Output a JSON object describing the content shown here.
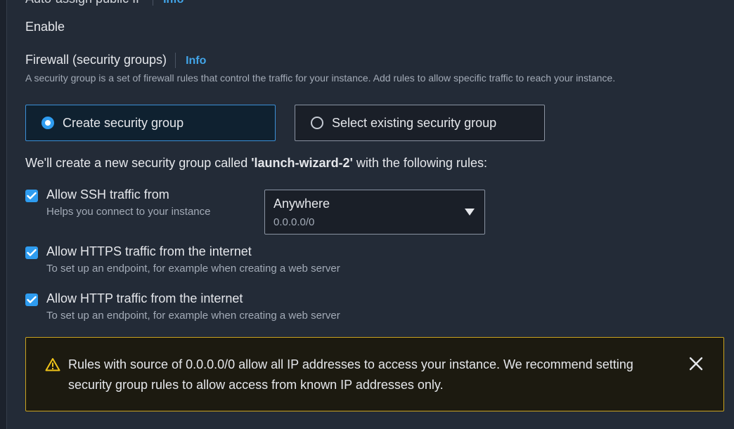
{
  "auto_assign": {
    "label": "Auto-assign public IP",
    "info": "Info",
    "value": "Enable"
  },
  "firewall": {
    "title": "Firewall (security groups)",
    "info": "Info",
    "description": "A security group is a set of firewall rules that control the traffic for your instance. Add rules to allow specific traffic to reach your instance.",
    "options": [
      {
        "label": "Create security group",
        "selected": true
      },
      {
        "label": "Select existing security group",
        "selected": false
      }
    ],
    "create_note_prefix": "We'll create a new security group called ",
    "group_name": "'launch-wizard-2'",
    "create_note_suffix": " with the following rules:"
  },
  "rules": [
    {
      "title": "Allow SSH traffic from",
      "hint": "Helps you connect to your instance",
      "checked": true
    },
    {
      "title": "Allow HTTPS traffic from the internet",
      "hint": "To set up an endpoint, for example when creating a web server",
      "checked": true
    },
    {
      "title": "Allow HTTP traffic from the internet",
      "hint": "To set up an endpoint, for example when creating a web server",
      "checked": true
    }
  ],
  "ssh_source": {
    "value": "Anywhere",
    "cidr": "0.0.0.0/0"
  },
  "alert": {
    "text": "Rules with source of 0.0.0.0/0 allow all IP addresses to access your instance. We recommend setting security group rules to allow access from known IP addresses only."
  },
  "colors": {
    "accent": "#2e9cf0",
    "info_link": "#42a5e8",
    "warning_border": "#c9a31f",
    "background": "#232b37"
  }
}
